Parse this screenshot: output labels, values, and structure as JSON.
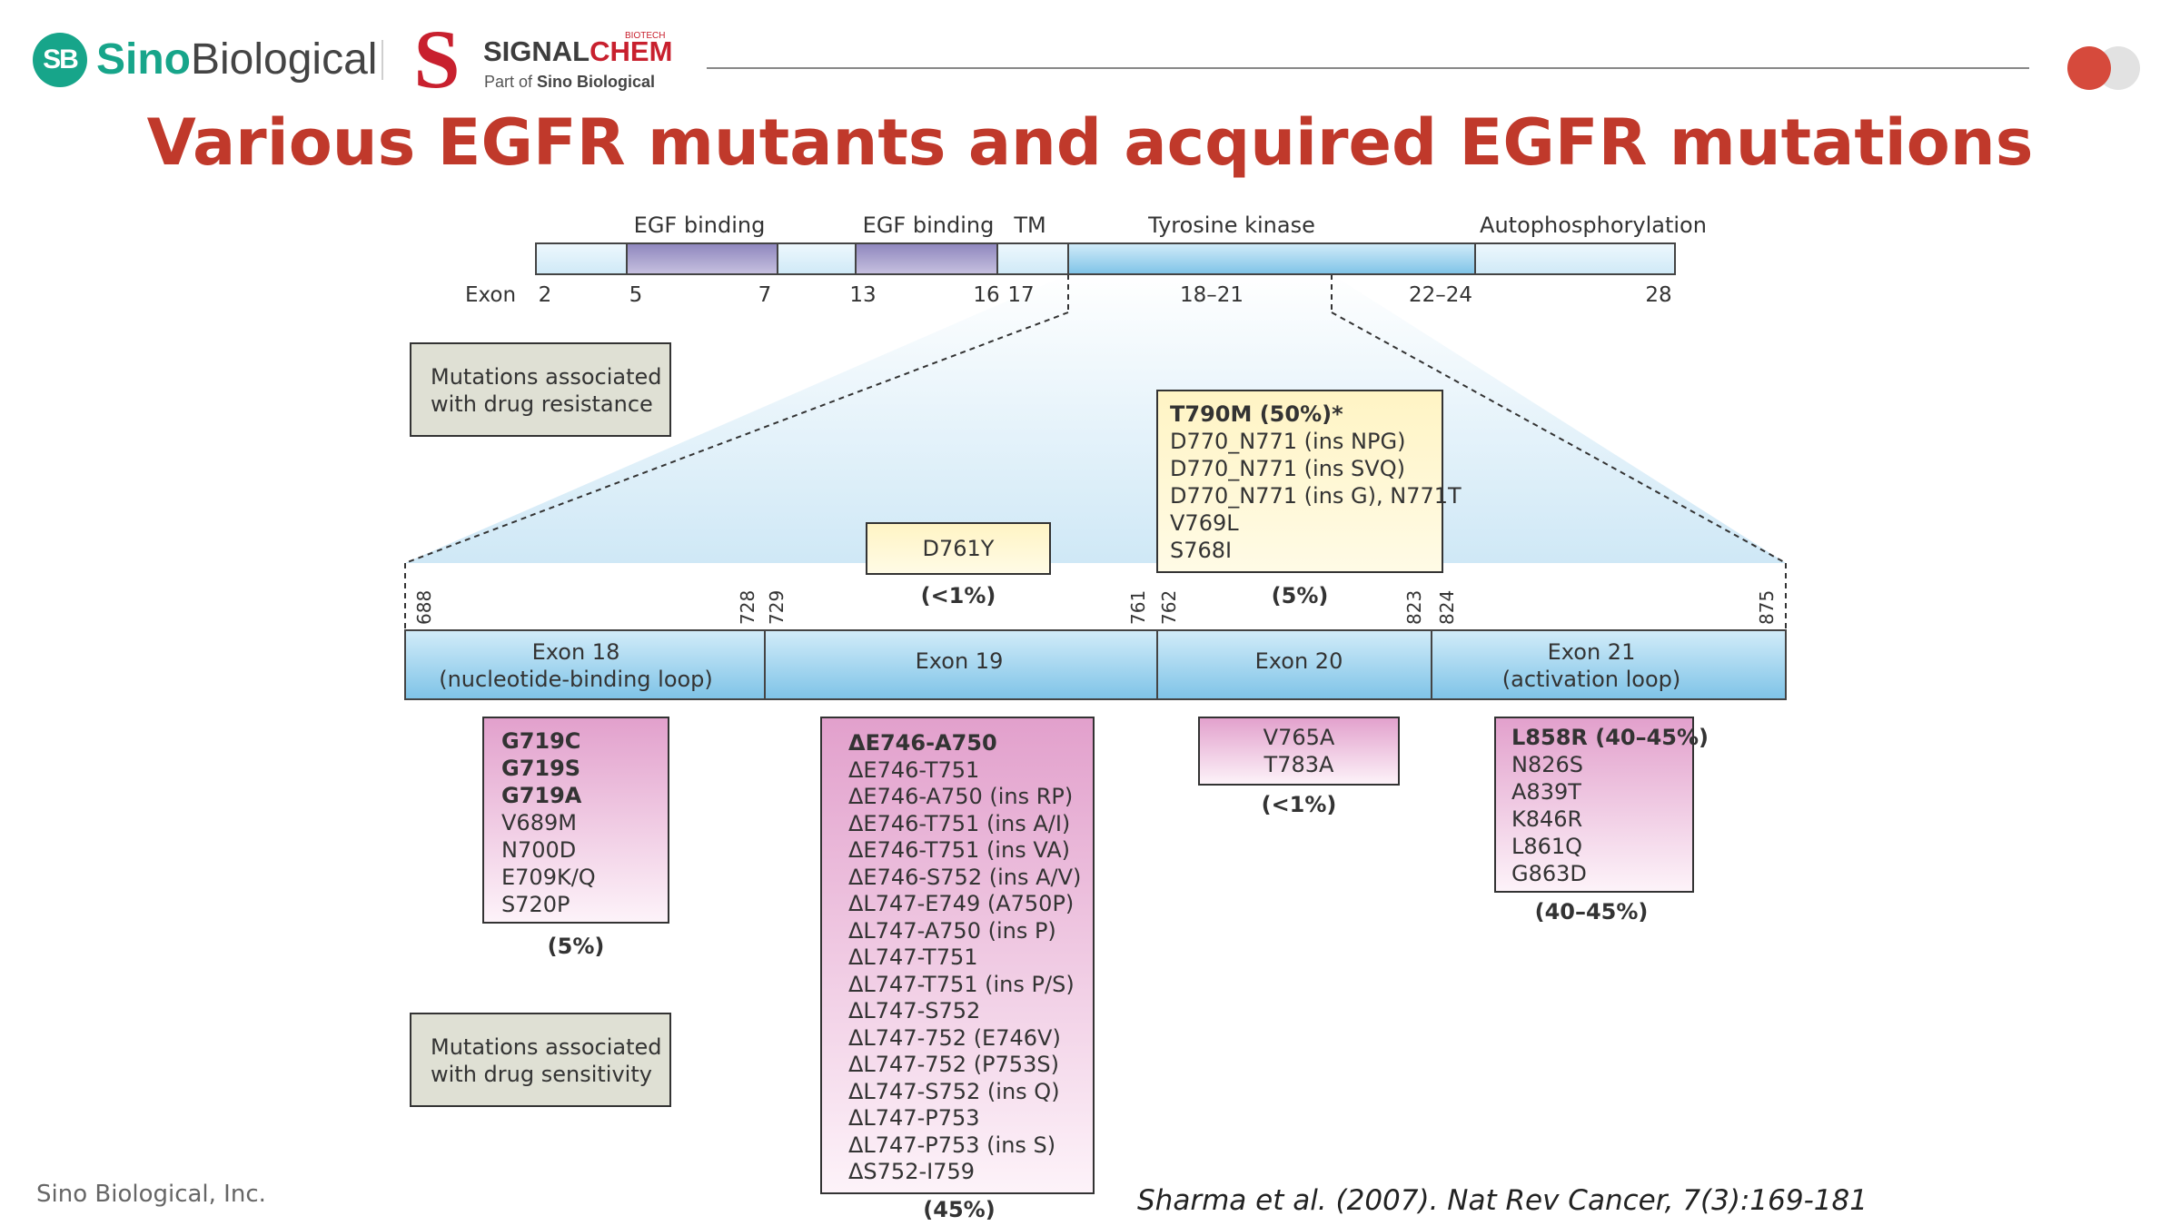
{
  "header": {
    "logo_sb": "SB",
    "logo_sino": "Sino",
    "logo_biological": "Biological",
    "logo_signal": "SIGNAL",
    "logo_chem": "CHEM",
    "logo_biotech": "BIOTECH",
    "logo_part_of": "Part of",
    "logo_part_brand": "Sino Biological"
  },
  "title": "Various EGFR mutants and acquired EGFR mutations",
  "domain_bar": {
    "labels": [
      "EGF binding",
      "EGF binding",
      "TM",
      "Tyrosine kinase",
      "Autophosphorylation"
    ],
    "exon_label": "Exon",
    "exon_numbers": [
      "2",
      "5",
      "7",
      "13",
      "16",
      "17",
      "18–21",
      "22–24",
      "28"
    ]
  },
  "legend": {
    "resistance_line1": "Mutations associated",
    "resistance_line2": "with drug resistance",
    "sensitivity_line1": "Mutations associated",
    "sensitivity_line2": "with drug sensitivity"
  },
  "positions": [
    "688",
    "728",
    "729",
    "761",
    "762",
    "823",
    "824",
    "875"
  ],
  "exon_bar": {
    "exon18_line1": "Exon 18",
    "exon18_line2": "(nucleotide-binding loop)",
    "exon19": "Exon 19",
    "exon20": "Exon 20",
    "exon21_line1": "Exon 21",
    "exon21_line2": "(activation loop)"
  },
  "resistance": {
    "d761y": "D761Y",
    "d761y_pct": "(<1%)",
    "exon20_items": [
      "T790M (50%)*",
      "D770_N771 (ins NPG)",
      "D770_N771 (ins SVQ)",
      "D770_N771 (ins G), N771T",
      "V769L",
      "S768I"
    ],
    "exon20_pct": "(5%)"
  },
  "sensitivity": {
    "exon18_items": [
      "G719C",
      "G719S",
      "G719A",
      "V689M",
      "N700D",
      "E709K/Q",
      "S720P"
    ],
    "exon18_pct": "(5%)",
    "exon19_items": [
      "ΔE746-A750",
      "ΔE746-T751",
      "ΔE746-A750 (ins RP)",
      "ΔE746-T751 (ins A/I)",
      "ΔE746-T751 (ins VA)",
      "ΔE746-S752 (ins A/V)",
      "ΔL747-E749 (A750P)",
      "ΔL747-A750 (ins P)",
      "ΔL747-T751",
      "ΔL747-T751 (ins P/S)",
      "ΔL747-S752",
      "ΔL747-752 (E746V)",
      "ΔL747-752 (P753S)",
      "ΔL747-S752 (ins Q)",
      "ΔL747-P753",
      "ΔL747-P753 (ins S)",
      "ΔS752-I759"
    ],
    "exon19_pct": "(45%)",
    "exon20_items": [
      "V765A",
      "T783A"
    ],
    "exon20_pct": "(<1%)",
    "exon21_items": [
      "L858R (40–45%)",
      "N826S",
      "A839T",
      "K846R",
      "L861Q",
      "G863D"
    ],
    "exon21_pct": "(40–45%)"
  },
  "footer": {
    "company": "Sino Biological, Inc.",
    "citation": "Sharma et al. (2007). Nat Rev Cancer, 7(3):169-181"
  },
  "colors": {
    "title_red": "#c0392b",
    "brand_green": "#17a58a",
    "signalchem_red": "#c8202e",
    "domain_purple": "#a79fc8",
    "kinase_blue": "#8fcbea",
    "legend_gray": "#dfe0d4",
    "resistance_yellow": "#fff9d6",
    "sensitivity_pink": "#e6aad2"
  }
}
